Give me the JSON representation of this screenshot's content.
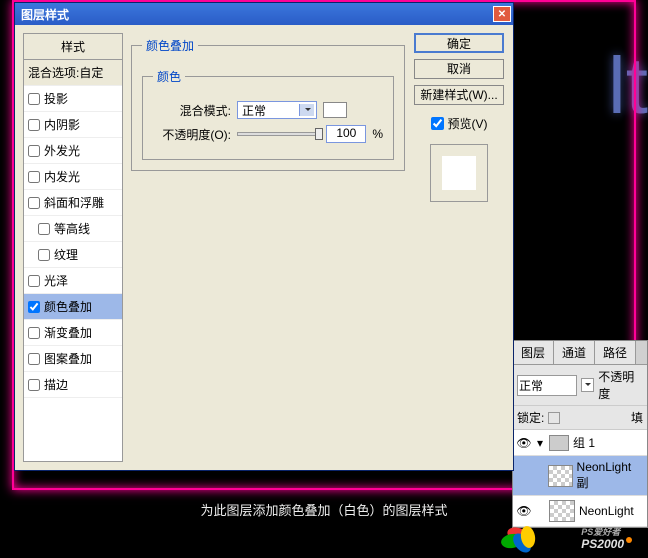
{
  "dialog": {
    "title": "图层样式",
    "styles_header": "样式",
    "blend_options": "混合选项:自定",
    "styles": [
      {
        "label": "投影",
        "checked": false
      },
      {
        "label": "内阴影",
        "checked": false
      },
      {
        "label": "外发光",
        "checked": false
      },
      {
        "label": "内发光",
        "checked": false
      },
      {
        "label": "斜面和浮雕",
        "checked": false
      },
      {
        "label": "等高线",
        "checked": false,
        "indent": true
      },
      {
        "label": "纹理",
        "checked": false,
        "indent": true
      },
      {
        "label": "光泽",
        "checked": false
      },
      {
        "label": "颜色叠加",
        "checked": true,
        "selected": true
      },
      {
        "label": "渐变叠加",
        "checked": false
      },
      {
        "label": "图案叠加",
        "checked": false
      },
      {
        "label": "描边",
        "checked": false
      }
    ],
    "panel_title": "颜色叠加",
    "color_group": "颜色",
    "blend_mode_label": "混合模式:",
    "blend_mode_value": "正常",
    "opacity_label": "不透明度(O):",
    "opacity_value": "100",
    "opacity_unit": "%",
    "ok": "确定",
    "cancel": "取消",
    "new_style": "新建样式(W)...",
    "preview": "预览(V)"
  },
  "layers_panel": {
    "tabs": [
      "图层",
      "通道",
      "路径"
    ],
    "mode": "正常",
    "opacity_label": "不透明度",
    "lock_label": "锁定:",
    "fill_label": "填",
    "group": "组 1",
    "layers": [
      {
        "name": "NeonLight 副",
        "visible": false
      },
      {
        "name": "NeonLight",
        "visible": true
      }
    ]
  },
  "caption": "为此图层添加颜色叠加（白色）的图层样式",
  "logo": {
    "line1": "PS爱好者",
    "line2": "PS2000"
  }
}
